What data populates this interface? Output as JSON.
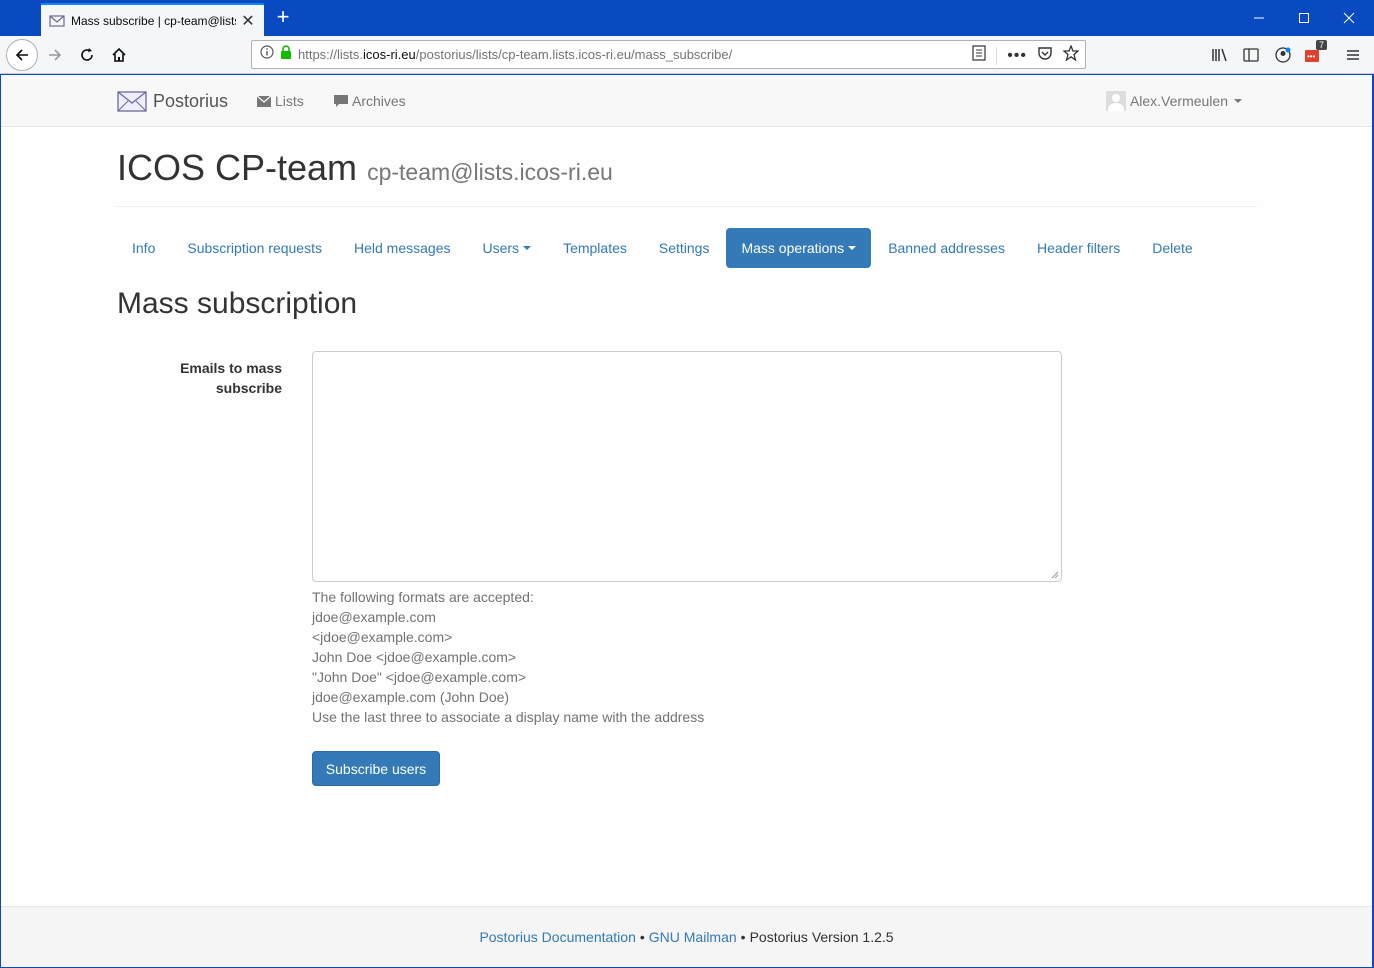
{
  "browser": {
    "tab_title": "Mass subscribe | cp-team@lists",
    "url_prefix": "https://lists.",
    "url_host": "icos-ri.eu",
    "url_path": "/postorius/lists/cp-team.lists.icos-ri.eu/mass_subscribe/",
    "badge_count": "7"
  },
  "navbar": {
    "brand": "Postorius",
    "lists_label": "Lists",
    "archives_label": "Archives",
    "user_name": "Alex.Vermeulen"
  },
  "header": {
    "list_name": "ICOS CP-team",
    "list_address": "cp-team@lists.icos-ri.eu"
  },
  "tabs": [
    {
      "label": "Info"
    },
    {
      "label": "Subscription requests"
    },
    {
      "label": "Held messages"
    },
    {
      "label": "Users"
    },
    {
      "label": "Templates"
    },
    {
      "label": "Settings"
    },
    {
      "label": "Mass operations"
    },
    {
      "label": "Banned addresses"
    },
    {
      "label": "Header filters"
    },
    {
      "label": "Delete"
    }
  ],
  "form": {
    "title": "Mass subscription",
    "label_line1": "Emails to mass",
    "label_line2": "subscribe",
    "textarea_value": "",
    "help_lines": [
      "The following formats are accepted:",
      "jdoe@example.com",
      "<jdoe@example.com>",
      "John Doe <jdoe@example.com>",
      "\"John Doe\" <jdoe@example.com>",
      "jdoe@example.com (John Doe)",
      "Use the last three to associate a display name with the address"
    ],
    "submit_label": "Subscribe users"
  },
  "footer": {
    "docs_link": "Postorius Documentation",
    "separator": "•",
    "mailman_link": "GNU Mailman",
    "version_text": "Postorius Version 1.2.5"
  },
  "colors": {
    "titlebar": "#0a4ac0",
    "primary": "#337ab7",
    "text": "#333333"
  }
}
